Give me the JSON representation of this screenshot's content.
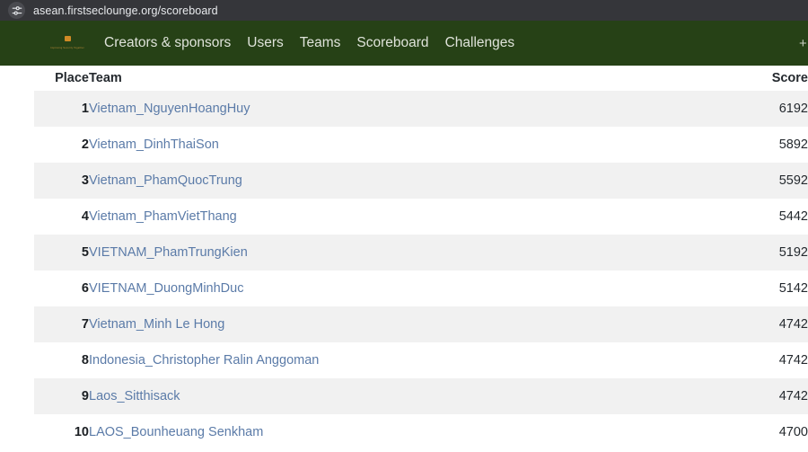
{
  "browser": {
    "url": "asean.firstseclounge.org/scoreboard",
    "site_settings_icon": "tune-sliders-icon"
  },
  "nav": {
    "logo_alt": "asean-logo",
    "logo_tagline": "Improving Security Together",
    "accent_color": "#d08a26",
    "bar_color": "#264116",
    "links": [
      {
        "label": "Creators & sponsors"
      },
      {
        "label": "Users"
      },
      {
        "label": "Teams"
      },
      {
        "label": "Scoreboard"
      },
      {
        "label": "Challenges"
      }
    ],
    "right_glyph": "+"
  },
  "scoreboard": {
    "columns": [
      "Place",
      "Team",
      "Score"
    ],
    "link_color": "#5b7ba8",
    "rows": [
      {
        "place": "1",
        "team": "Vietnam_NguyenHoangHuy",
        "score": "6192"
      },
      {
        "place": "2",
        "team": "Vietnam_DinhThaiSon",
        "score": "5892"
      },
      {
        "place": "3",
        "team": "Vietnam_PhamQuocTrung",
        "score": "5592"
      },
      {
        "place": "4",
        "team": "Vietnam_PhamVietThang",
        "score": "5442"
      },
      {
        "place": "5",
        "team": "VIETNAM_PhamTrungKien",
        "score": "5192"
      },
      {
        "place": "6",
        "team": "VIETNAM_DuongMinhDuc",
        "score": "5142"
      },
      {
        "place": "7",
        "team": "Vietnam_Minh Le Hong",
        "score": "4742"
      },
      {
        "place": "8",
        "team": "Indonesia_Christopher Ralin Anggoman",
        "score": "4742"
      },
      {
        "place": "9",
        "team": "Laos_Sitthisack",
        "score": "4742"
      },
      {
        "place": "10",
        "team": "LAOS_Bounheuang Senkham",
        "score": "4700"
      }
    ]
  }
}
